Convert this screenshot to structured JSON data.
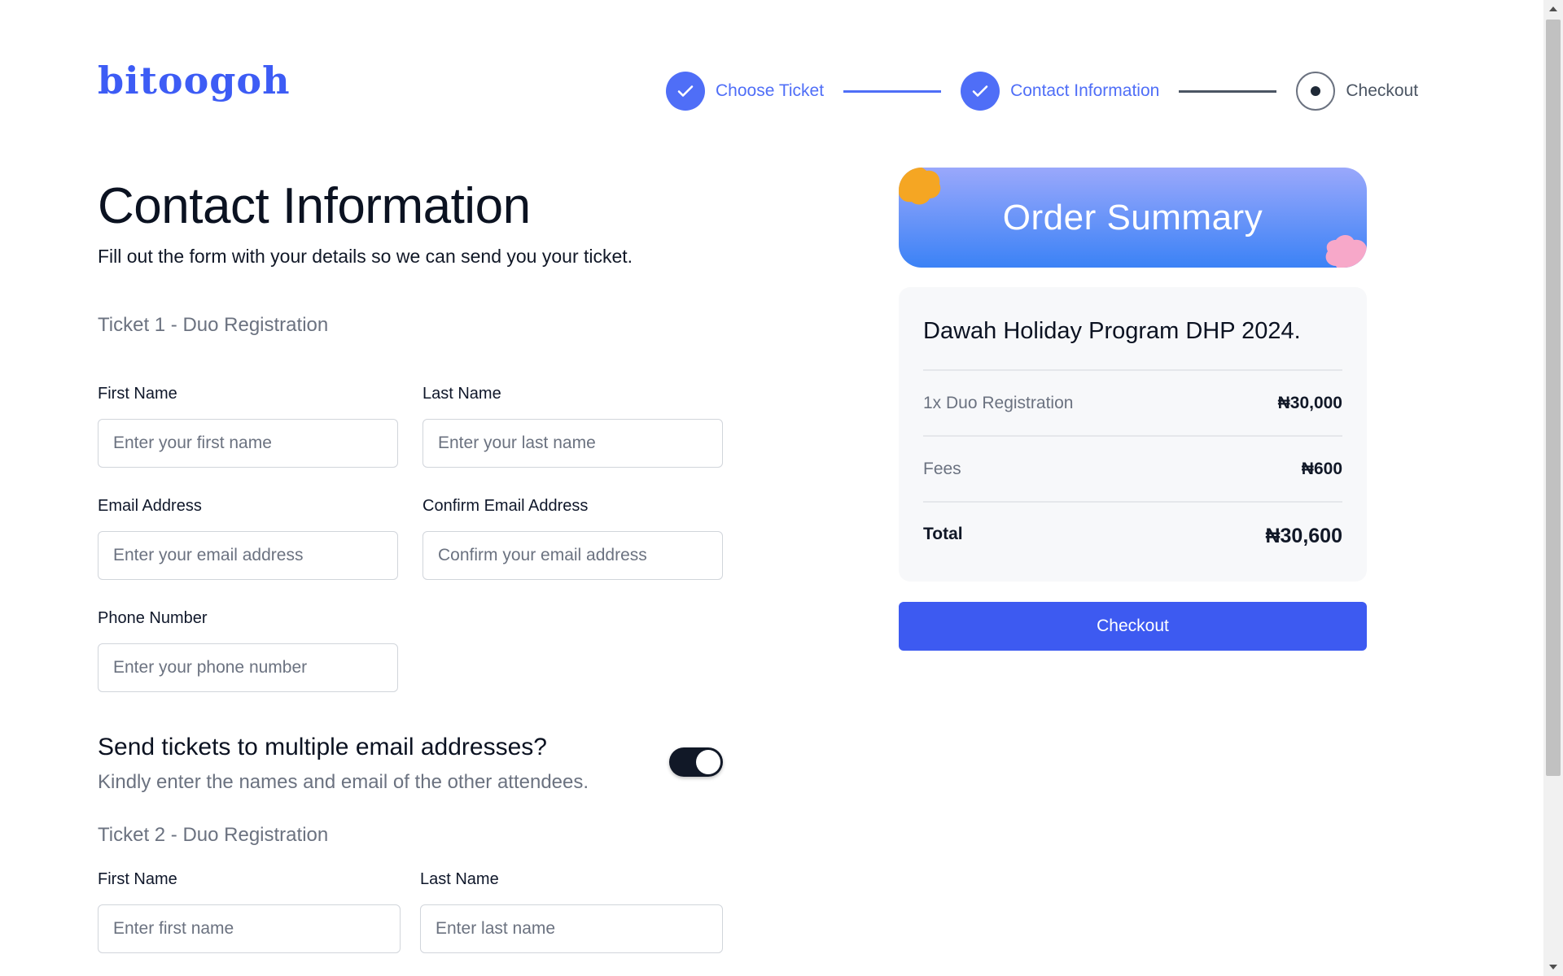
{
  "brand": {
    "logo_text": "bitoogoh",
    "accent_color": "#3d5af1"
  },
  "stepper": {
    "steps": [
      {
        "label": "Choose Ticket",
        "status": "done",
        "icon": "check-icon"
      },
      {
        "label": "Contact Information",
        "status": "done",
        "icon": "check-icon"
      },
      {
        "label": "Checkout",
        "status": "current",
        "icon": "dot-icon"
      }
    ]
  },
  "form": {
    "title": "Contact Information",
    "subtitle": "Fill out the form with your details so we can send you your ticket.",
    "ticket1": {
      "title": "Ticket 1 - Duo Registration",
      "first_name_label": "First Name",
      "first_name_placeholder": "Enter your first name",
      "last_name_label": "Last Name",
      "last_name_placeholder": "Enter your last name",
      "email_label": "Email Address",
      "email_placeholder": "Enter your email address",
      "confirm_email_label": "Confirm Email Address",
      "confirm_email_placeholder": "Confirm your email address",
      "phone_label": "Phone Number",
      "phone_placeholder": "Enter your phone number"
    },
    "multiple_emails": {
      "title": "Send tickets to multiple email addresses?",
      "subtitle": "Kindly enter the names and email of the other attendees.",
      "toggle_on": true
    },
    "ticket2": {
      "title": "Ticket 2 - Duo Registration",
      "first_name_label": "First Name",
      "first_name_placeholder": "Enter first name",
      "last_name_label": "Last Name",
      "last_name_placeholder": "Enter last name"
    }
  },
  "summary": {
    "banner_title": "Order Summary",
    "event_name": "Dawah Holiday Program DHP 2024.",
    "line_item_label": "1x Duo Registration",
    "line_item_value": "₦30,000",
    "fees_label": "Fees",
    "fees_value": "₦600",
    "total_label": "Total",
    "total_value": "₦30,600",
    "checkout_label": "Checkout"
  }
}
